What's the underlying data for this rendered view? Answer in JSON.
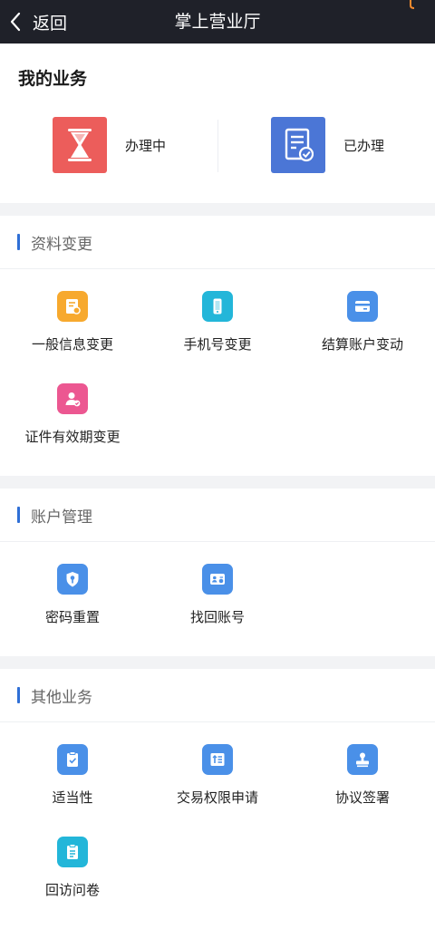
{
  "header": {
    "back_label": "返回",
    "title": "掌上营业厅"
  },
  "my_business": {
    "title": "我的业务",
    "items": [
      {
        "label": "办理中",
        "icon": "hourglass-icon",
        "color": "#ec5d5b"
      },
      {
        "label": "已办理",
        "icon": "document-check-icon",
        "color": "#4b76d6"
      }
    ]
  },
  "sections": [
    {
      "title": "资料变更",
      "items": [
        {
          "label": "一般信息变更",
          "icon": "document-edit-icon",
          "color": "#f7a92e"
        },
        {
          "label": "手机号变更",
          "icon": "mobile-phone-icon",
          "color": "#23b6d9"
        },
        {
          "label": "结算账户变动",
          "icon": "card-icon",
          "color": "#4a90e8"
        },
        {
          "label": "证件有效期变更",
          "icon": "user-check-icon",
          "color": "#ec5791"
        }
      ]
    },
    {
      "title": "账户管理",
      "items": [
        {
          "label": "密码重置",
          "icon": "shield-key-icon",
          "color": "#4a90e8"
        },
        {
          "label": "找回账号",
          "icon": "id-card-icon",
          "color": "#4a90e8"
        }
      ]
    },
    {
      "title": "其他业务",
      "items": [
        {
          "label": "适当性",
          "icon": "clipboard-check-icon",
          "color": "#4a90e8"
        },
        {
          "label": "交易权限申请",
          "icon": "permission-list-icon",
          "color": "#4a90e8"
        },
        {
          "label": "协议签署",
          "icon": "stamp-icon",
          "color": "#4a90e8"
        },
        {
          "label": "回访问卷",
          "icon": "survey-icon",
          "color": "#23b6d9"
        }
      ]
    }
  ],
  "colors": {
    "topbar": "#1f2129",
    "accent_bar": "#2f6fd6",
    "page_bg": "#f2f3f5"
  }
}
